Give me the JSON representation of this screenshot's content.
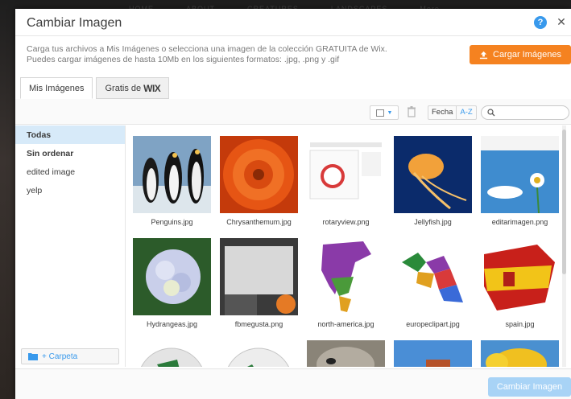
{
  "backdrop": {
    "nav": [
      "HOME",
      "ABOUT",
      "CREATURES",
      "LANDSCAPES",
      "More"
    ]
  },
  "dialog": {
    "title": "Cambiar Imagen",
    "help_icon": "question-circle-icon",
    "close_icon": "close-icon",
    "intro_line1": "Carga tus archivos a Mis Imágenes o selecciona una imagen de la colección GRATUITA de Wix.",
    "intro_line2": "Puedes cargar imágenes de hasta 10Mb en los siguientes formatos: .jpg, .png y .gif",
    "upload_label": "Cargar Imágenes",
    "accent_color": "#f58220",
    "primary_color": "#3899ec"
  },
  "tabs": [
    {
      "label": "Mis Imágenes",
      "active": true
    },
    {
      "label": "Gratis de",
      "brand": "WIX",
      "active": false
    }
  ],
  "toolbar": {
    "sort_date": "Fecha",
    "sort_az": "A-Z",
    "search_placeholder": ""
  },
  "sidebar": {
    "items": [
      {
        "label": "Todas",
        "selected": true,
        "bold": true
      },
      {
        "label": "Sin ordenar",
        "selected": false,
        "bold": true
      },
      {
        "label": "edited image",
        "selected": false,
        "bold": false
      },
      {
        "label": "yelp",
        "selected": false,
        "bold": false
      }
    ],
    "add_folder": "+ Carpeta"
  },
  "images": [
    "Penguins.jpg",
    "Chrysanthemum.jpg",
    "rotaryview.png",
    "Jellyfish.jpg",
    "editarimagen.png",
    "Hydrangeas.jpg",
    "fbmegusta.png",
    "north-america.jpg",
    "europeclipart.jpg",
    "spain.jpg",
    "",
    "",
    "",
    "",
    ""
  ],
  "footer": {
    "confirm_label": "Cambiar Imagen"
  }
}
